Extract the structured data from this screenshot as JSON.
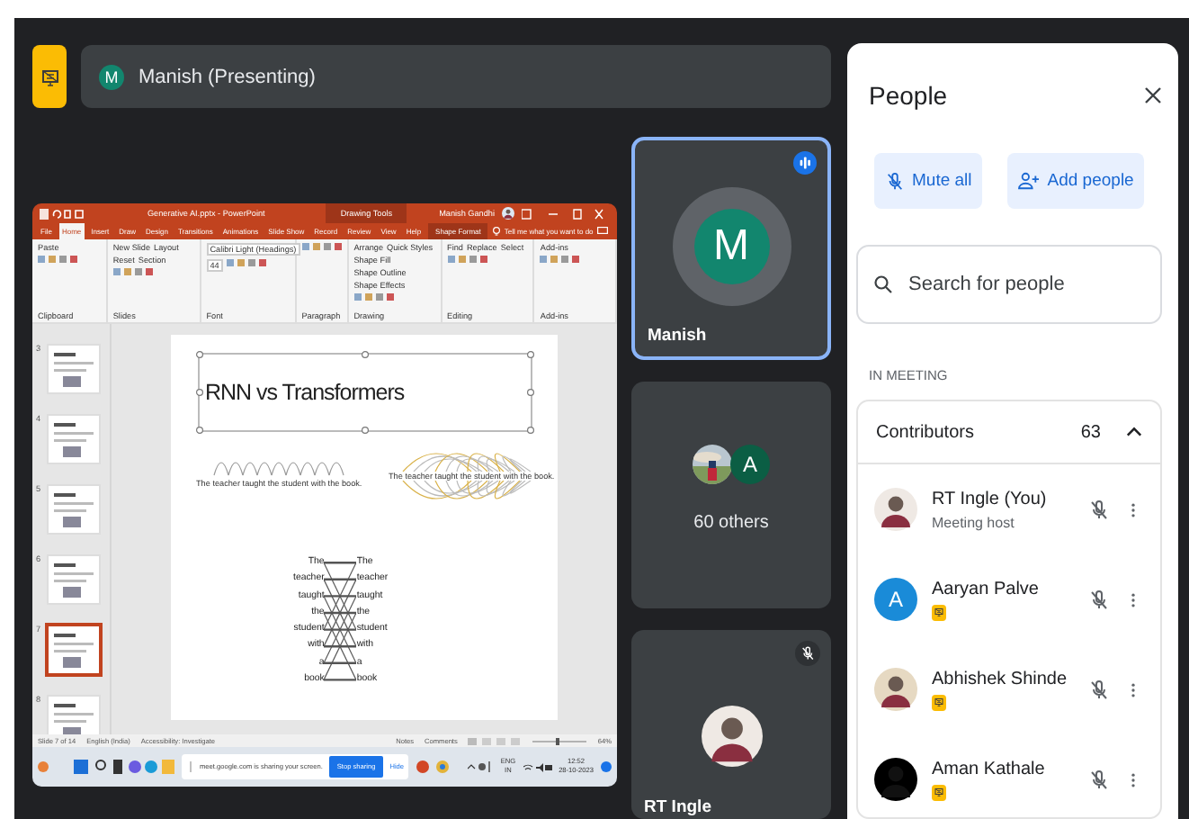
{
  "presenter_bar": {
    "initial": "M",
    "label": "Manish (Presenting)"
  },
  "shared_screen": {
    "title": "Generative AI.pptx - PowerPoint",
    "user": "Manish Gandhi",
    "ribbon_tabs": [
      {
        "label": "File",
        "selected": false
      },
      {
        "label": "Home",
        "selected": true
      },
      {
        "label": "Insert",
        "selected": false
      },
      {
        "label": "Draw",
        "selected": false
      },
      {
        "label": "Design",
        "selected": false
      },
      {
        "label": "Transitions",
        "selected": false
      },
      {
        "label": "Animations",
        "selected": false
      },
      {
        "label": "Slide Show",
        "selected": false
      },
      {
        "label": "Record",
        "selected": false
      },
      {
        "label": "Review",
        "selected": false
      },
      {
        "label": "View",
        "selected": false
      },
      {
        "label": "Help",
        "selected": false
      }
    ],
    "context_tab": {
      "group": "Drawing Tools",
      "label": "Shape Format"
    },
    "tell_me": "Tell me what you want to do",
    "ribbon_groups": [
      {
        "label": "Clipboard",
        "buttons": [
          {
            "label": "Paste",
            "kind": "button"
          }
        ]
      },
      {
        "label": "Slides",
        "buttons": [
          {
            "label": "New Slide",
            "kind": "button"
          },
          {
            "label": "Layout",
            "kind": "button"
          },
          {
            "label": "Reset",
            "kind": "button"
          },
          {
            "label": "Section",
            "kind": "button"
          }
        ]
      },
      {
        "label": "Font",
        "buttons": [
          {
            "label": "Calibri Light (Headings)",
            "kind": "field"
          },
          {
            "label": "44",
            "kind": "field"
          }
        ]
      },
      {
        "label": "Paragraph"
      },
      {
        "label": "Drawing",
        "buttons": [
          {
            "label": "Arrange",
            "kind": "button"
          },
          {
            "label": "Quick Styles",
            "kind": "button"
          },
          {
            "label": "Shape Fill",
            "kind": "button"
          },
          {
            "label": "Shape Outline",
            "kind": "button"
          },
          {
            "label": "Shape Effects",
            "kind": "button"
          }
        ]
      },
      {
        "label": "Editing",
        "buttons": [
          {
            "label": "Find",
            "kind": "button"
          },
          {
            "label": "Replace",
            "kind": "button"
          },
          {
            "label": "Select",
            "kind": "button"
          }
        ]
      },
      {
        "label": "Add-ins",
        "buttons": [
          {
            "label": "Add-ins",
            "kind": "button"
          }
        ]
      }
    ],
    "thumbnails": [
      {
        "number": "3",
        "selected": false
      },
      {
        "number": "4",
        "selected": false
      },
      {
        "number": "5",
        "selected": false
      },
      {
        "number": "6",
        "selected": false
      },
      {
        "number": "7",
        "selected": true
      },
      {
        "number": "8",
        "selected": false
      }
    ],
    "slide": {
      "title": "RNN vs Transformers",
      "captions": [
        "The teacher taught the student with the book.",
        "The teacher taught the student with the book."
      ],
      "left_words": [
        "The",
        "teacher",
        "taught",
        "the",
        "student",
        "with",
        "a",
        "book"
      ],
      "right_words": [
        "The",
        "teacher",
        "taught",
        "the",
        "student",
        "with",
        "a",
        "book"
      ]
    },
    "status_bar": {
      "slide_count": "Slide 7 of 14",
      "language": "English (India)",
      "accessibility": "Accessibility: Investigate",
      "notes": "Notes",
      "comments": "Comments",
      "zoom": "64%"
    },
    "taskbar": {
      "sharing_message": "meet.google.com is sharing your screen.",
      "stop_button": "Stop sharing",
      "hide_link": "Hide",
      "language": "ENG",
      "region": "IN",
      "time": "12:52",
      "date": "28-10-2023"
    }
  },
  "tiles": [
    {
      "kind": "initial",
      "name": "Manish",
      "initial": "M",
      "speaking": true
    },
    {
      "kind": "group",
      "label": "60 others",
      "initial": "A"
    },
    {
      "name": "RT Ingle",
      "muted": true
    }
  ],
  "people_panel": {
    "title": "People",
    "buttons": [
      "Mute all",
      "Add people"
    ],
    "search": {
      "placeholder": "Search for people"
    },
    "section": "IN MEETING",
    "group": {
      "label": "Contributors",
      "count": "63",
      "expanded": true
    },
    "participants": [
      {
        "name": "RT Ingle (You)",
        "role": "Meeting host",
        "presenting": false,
        "muted": true
      },
      {
        "name": "Aaryan Palve",
        "avatar": {
          "kind": "initial",
          "letter": "A",
          "color": "#1a8bd8"
        },
        "presenting": true,
        "muted": true
      },
      {
        "name": "Abhishek Shinde",
        "presenting": true,
        "muted": true
      },
      {
        "name": "Aman Kathale",
        "presenting": true,
        "muted": true
      }
    ]
  }
}
